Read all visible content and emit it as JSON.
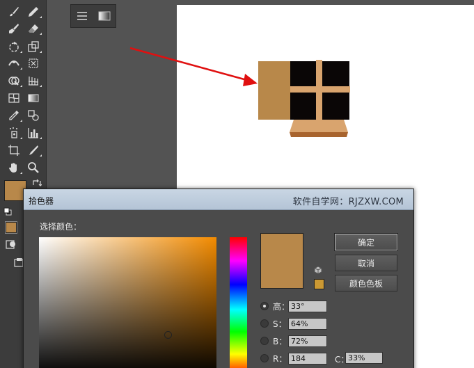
{
  "toolbar": {
    "tools": [
      {
        "name": "paintbrush-tool",
        "icon": "brush-icon"
      },
      {
        "name": "pencil-tool",
        "icon": "pencil-icon"
      },
      {
        "name": "blob-brush-tool",
        "icon": "blob-brush-icon"
      },
      {
        "name": "eraser-tool",
        "icon": "eraser-icon"
      },
      {
        "name": "rotate-tool",
        "icon": "rotate-icon"
      },
      {
        "name": "scale-tool",
        "icon": "scale-icon"
      },
      {
        "name": "width-tool",
        "icon": "width-icon"
      },
      {
        "name": "free-transform-tool",
        "icon": "free-transform-icon"
      },
      {
        "name": "shape-builder-tool",
        "icon": "shape-builder-icon"
      },
      {
        "name": "perspective-grid-tool",
        "icon": "perspective-grid-icon"
      },
      {
        "name": "mesh-tool",
        "icon": "mesh-icon"
      },
      {
        "name": "gradient-tool",
        "icon": "gradient-icon"
      },
      {
        "name": "eyedropper-tool",
        "icon": "eyedropper-icon"
      },
      {
        "name": "blend-tool",
        "icon": "blend-icon"
      },
      {
        "name": "symbol-sprayer-tool",
        "icon": "symbol-sprayer-icon"
      },
      {
        "name": "column-graph-tool",
        "icon": "column-graph-icon"
      },
      {
        "name": "artboard-tool",
        "icon": "artboard-icon"
      },
      {
        "name": "slice-tool",
        "icon": "slice-icon"
      },
      {
        "name": "hand-tool",
        "icon": "hand-icon"
      },
      {
        "name": "zoom-tool",
        "icon": "zoom-icon"
      }
    ],
    "fill_color": "#b8884a"
  },
  "artwork": {
    "brown_block_color": "#b8884a",
    "window_color": "#0a0606",
    "cross_color": "#d9a46e",
    "base_top_color": "#d9a46e",
    "base_bottom_color": "#a8642e",
    "arrow_color": "#e01010"
  },
  "picker": {
    "title": "拾色器",
    "watermark": "软件自学网：RJZXW.COM",
    "select_label": "选择颜色：",
    "new_color": "#b8884a",
    "web_safe_color": "#cc9933",
    "buttons": {
      "ok": "确定",
      "cancel": "取消",
      "swatches": "颜色色板"
    },
    "fields": [
      {
        "label": "高：",
        "value": "33°",
        "selected": true
      },
      {
        "label": "S：",
        "value": "64%",
        "selected": false
      },
      {
        "label": "B：",
        "value": "72%",
        "selected": false
      },
      {
        "label": "R：",
        "value": "184",
        "selected": false
      }
    ],
    "c_label": "C：",
    "c_value": "33%"
  }
}
